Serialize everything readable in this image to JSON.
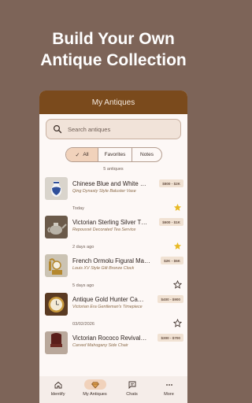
{
  "headline": {
    "line1": "Build Your Own",
    "line2": "Antique Collection"
  },
  "appbar": {
    "title": "My Antiques"
  },
  "search": {
    "placeholder": "Search antiques"
  },
  "filters": {
    "all": "All",
    "favorites": "Favorites",
    "notes": "Notes",
    "selected": "All"
  },
  "count": "5 antiques",
  "items": [
    {
      "title": "Chinese Blue and White …",
      "subtitle": "Qing Dynasty Style Baluster Vase",
      "price": "$800 - $2K",
      "date": "Today",
      "favorite": true,
      "icon": "vase-photo"
    },
    {
      "title": "Victorian Sterling Silver T…",
      "subtitle": "Repoussé Decorated Tea Service",
      "price": "$600 - $1K",
      "date": "2 days ago",
      "favorite": true,
      "icon": "teapot-photo"
    },
    {
      "title": "French Ormolu Figural Ma…",
      "subtitle": "Louis XV Style Gilt Bronze Clock",
      "price": "$2K - $5K",
      "date": "5 days ago",
      "favorite": false,
      "icon": "clock-photo"
    },
    {
      "title": "Antique Gold Hunter Ca…",
      "subtitle": "Victorian Era Gentleman's Timepiece",
      "price": "$400 - $900",
      "date": "03/02/2026",
      "favorite": false,
      "icon": "pocket-watch-photo"
    },
    {
      "title": "Victorian Rococo Revival…",
      "subtitle": "Carved Mahogany Side Chair",
      "price": "$300 - $700",
      "date": "",
      "favorite": false,
      "icon": "chair-photo"
    }
  ],
  "nav": [
    {
      "label": "Identify",
      "icon": "home-icon",
      "active": false
    },
    {
      "label": "My Antiques",
      "icon": "diamond-icon",
      "active": true
    },
    {
      "label": "Chats",
      "icon": "chat-icon",
      "active": false
    },
    {
      "label": "More",
      "icon": "more-icon",
      "active": false
    }
  ],
  "colors": {
    "background": "#7d6458",
    "appbar": "#7a4a1c",
    "accent": "#f1d2bb",
    "star": "#e8b923"
  }
}
